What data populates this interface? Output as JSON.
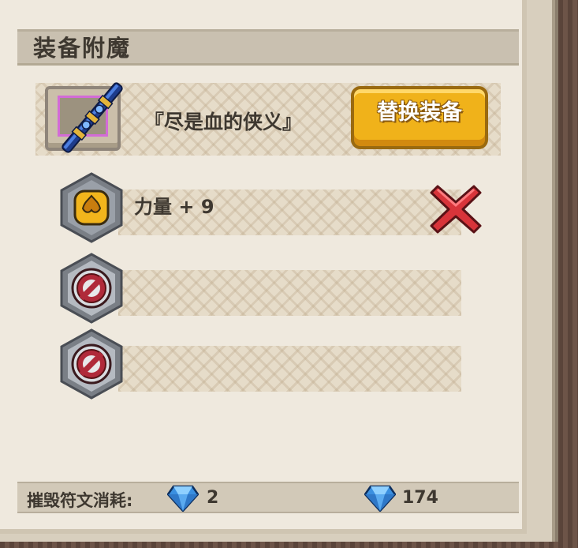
{
  "header": {
    "title": "装备附魔"
  },
  "equipment": {
    "name": "『尽是血的侠义』",
    "replace_label": "替换装备"
  },
  "runes": [
    {
      "text": "力量 + 9",
      "icon": "strength-rune-icon",
      "state": "filled"
    },
    {
      "text": "",
      "icon": "locked-slot-icon",
      "state": "locked"
    },
    {
      "text": "",
      "icon": "locked-slot-icon",
      "state": "locked"
    }
  ],
  "footer": {
    "destroy_cost_label": "摧毁符文消耗:",
    "destroy_cost_value": "2",
    "gem_balance": "174"
  },
  "colors": {
    "accent_button": "#f0b21a",
    "remove_red": "#d8343a",
    "gem_blue": "#3a8fe0"
  }
}
